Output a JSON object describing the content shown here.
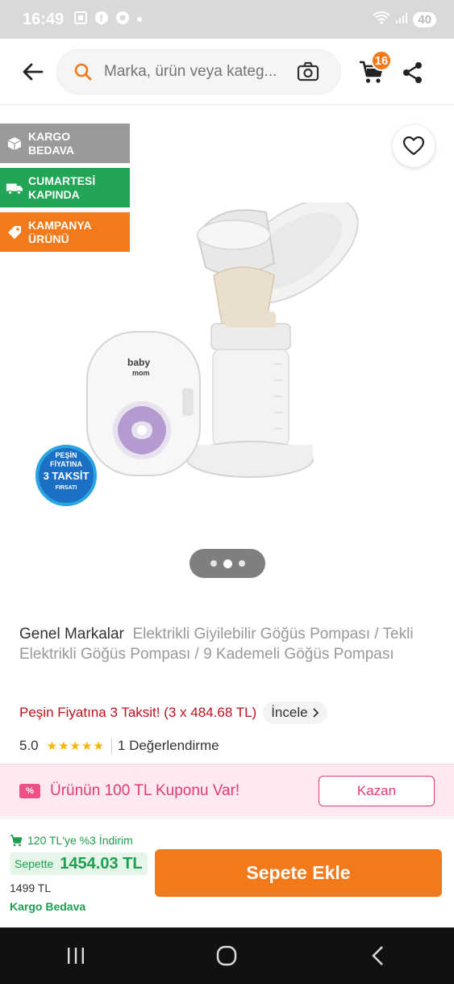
{
  "status_bar": {
    "time": "16:49",
    "battery": "40"
  },
  "search": {
    "placeholder": "Marka, ürün veya kateg..."
  },
  "cart": {
    "count": "16"
  },
  "badges": [
    {
      "line1": "KARGO",
      "line2": "BEDAVA",
      "color": "#9a9a9a"
    },
    {
      "line1": "CUMARTESİ",
      "line2": "KAPINDA",
      "color": "#23a556"
    },
    {
      "line1": "KAMPANYA",
      "line2": "ÜRÜNÜ",
      "color": "#f27a1a"
    }
  ],
  "product_sticker": {
    "line1": "PEŞİN",
    "line2": "FİYATINA",
    "line3": "3 TAKSİT",
    "line4": "FIRSATI"
  },
  "product_logo": {
    "line1": "baby",
    "line2": "mom"
  },
  "title": {
    "brand": "Genel Markalar",
    "name": "Elektrikli Giyilebilir Göğüs Pompası / Tekli Elektrikli Göğüs Pompası / 9 Kademeli Göğüs Pompası"
  },
  "installment": {
    "text": "Peşin Fiyatına 3 Taksit! (3 x 484.68 TL)",
    "link": "İncele"
  },
  "rating": {
    "score": "5.0",
    "stars": "★★★★★",
    "reviews": "1 Değerlendirme"
  },
  "coupon": {
    "icon_text": "%",
    "text": "Ürünün 100 TL Kuponu Var!",
    "button": "Kazan"
  },
  "bottom": {
    "promo": "120 TL'ye %3 İndirim",
    "basket_label": "Sepette",
    "basket_price": "1454.03 TL",
    "old_price": "1499 TL",
    "cargo": "Kargo Bedava",
    "add_button": "Sepete Ekle"
  },
  "colors": {
    "accent": "#f27a1a",
    "green": "#1e9e4f",
    "pink": "#e33a74",
    "red": "#c0101e"
  },
  "pager": {
    "pages": 3,
    "active_index": 1
  }
}
